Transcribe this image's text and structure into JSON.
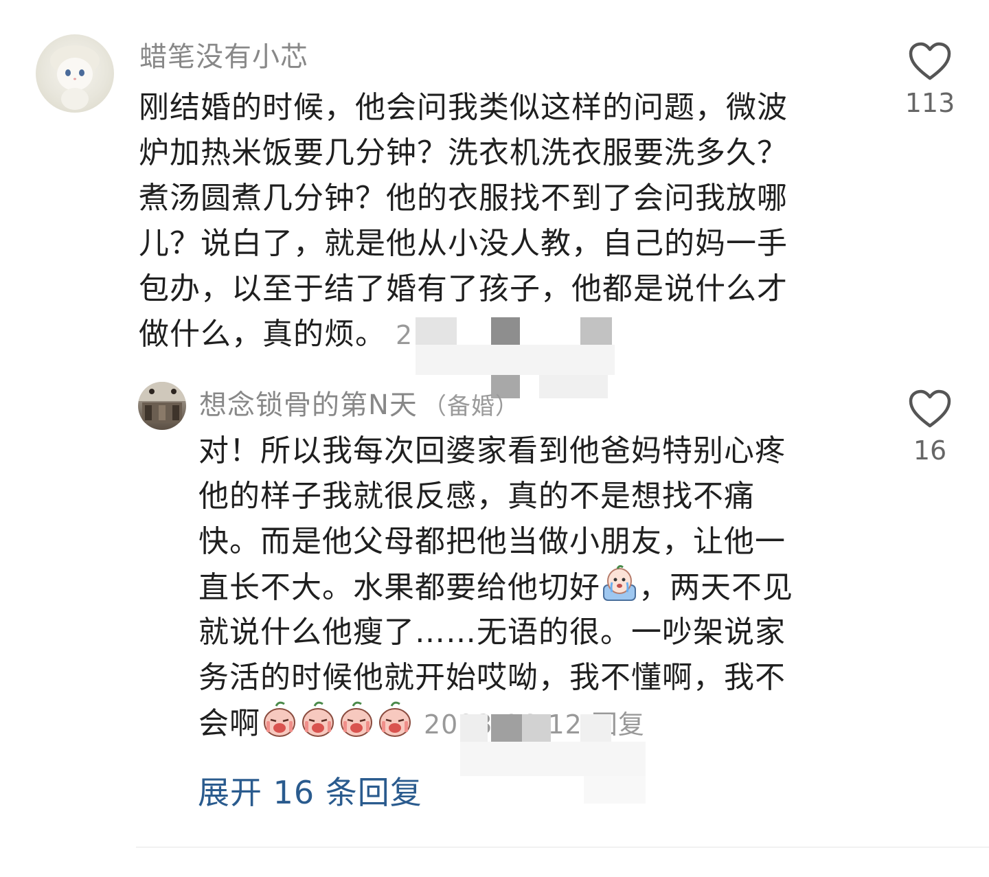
{
  "comments": [
    {
      "username": "蜡笔没有小芯",
      "lines": [
        "刚结婚的时候，他会问我类似这样的问题，微波",
        "炉加热米饭要几分钟？洗衣机洗衣服要洗多久？",
        "煮汤圆煮几分钟？他的衣服找不到了会问我放哪",
        "儿？说白了，就是他从小没人教，自己的妈一手",
        "包办，以至于结了婚有了孩子，他都是说什么才",
        "做什么，真的烦。"
      ],
      "meta_fragment": "2",
      "likes": "113",
      "icon": "heart-outline-icon"
    }
  ],
  "reply": {
    "username": "想念锁骨的第N天",
    "badge": "（备婚）",
    "lines": [
      "对！所以我每次回婆家看到他爸妈特别心疼",
      "他的样子我就很反感，真的不是想找不痛",
      "快。而是他父母都把他当做小朋友，让他一"
    ],
    "line4_before": "直长不大。水果都要给他切好",
    "line4_after": "，两天不见",
    "lines_rest": [
      "就说什么他瘦了……无语的很。一吵架说家",
      "务活的时候他就开始哎呦，我不懂啊，我不"
    ],
    "last_line_text": "会啊",
    "meta_fragment": "2023-06-12 回复",
    "likes": "16",
    "icon": "heart-outline-icon",
    "emojis": [
      "crying-face-emoji",
      "sobbing-face-emoji",
      "sobbing-face-emoji",
      "sobbing-face-emoji",
      "sobbing-face-emoji"
    ]
  },
  "expand_label": "展开 16 条回复",
  "colors": {
    "username": "#888888",
    "text": "#1f1f1f",
    "link": "#2a5b8e",
    "like_count": "#666666",
    "divider": "#e6e6e6"
  }
}
